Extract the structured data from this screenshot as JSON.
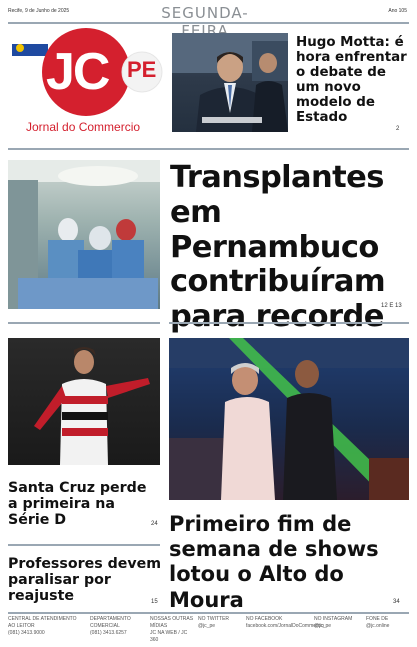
{
  "masthead": {
    "date": "Recife, 9 de Junho de 2025",
    "weekday": "SEGUNDA-FEIRA",
    "edition": "Ano 105",
    "logo_letters": "JC",
    "logo_suffix": "PE",
    "newspaper_name": "Jornal do Commercio"
  },
  "stories": {
    "top": {
      "headline": "Hugo Motta: é hora enfrentar o debate de um novo modelo de Estado",
      "page": "2"
    },
    "main": {
      "headline": "Transplantes em Pernambuco contribuíram para recorde do SUS",
      "page": "12 E 13"
    },
    "sport": {
      "headline": "Santa Cruz perde a primeira na Série D",
      "page": "24"
    },
    "shows": {
      "headline": "Primeiro fim de semana de shows lotou o Alto do Moura",
      "page": "34"
    },
    "teachers": {
      "headline": "Professores devem paralisar por reajuste",
      "page": "15"
    }
  },
  "footer": [
    {
      "title": "CENTRAL DE ATENDIMENTO AO LEITOR",
      "value": "(081) 3413.9000"
    },
    {
      "title": "DEPARTAMENTO COMERCIAL",
      "value": "(081) 3413.6257"
    },
    {
      "title": "NOSSAS OUTRAS MÍDIAS",
      "value": "JC NA WEB / JC 360"
    },
    {
      "title": "NO TWITTER",
      "value": "@jc_pe"
    },
    {
      "title": "NO FACEBOOK",
      "value": "facebook.com/JornalDoCommercio"
    },
    {
      "title": "NO INSTAGRAM",
      "value": "@jc_pe"
    },
    {
      "title": "FONE DE",
      "value": "@jc.online"
    }
  ],
  "colors": {
    "brand_red": "#d4202e",
    "flag_blue": "#1f4aa0",
    "flag_yellow": "#f2c400",
    "rule": "#9aa7b3"
  }
}
